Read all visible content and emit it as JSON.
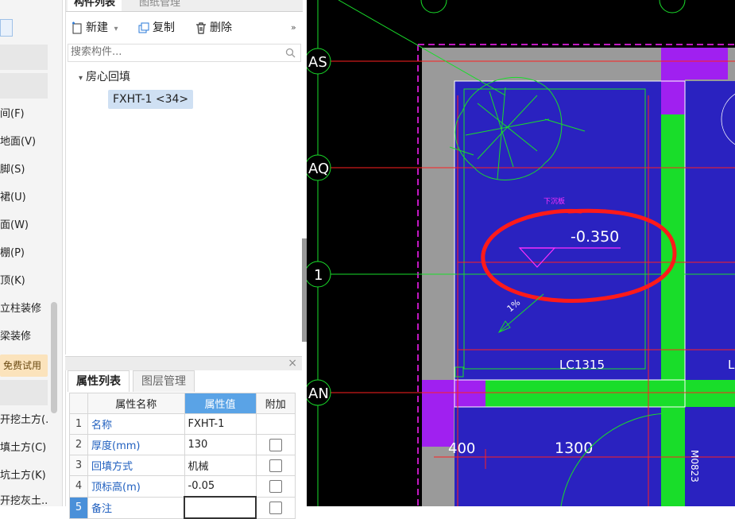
{
  "nav": {
    "items": [
      "间(F)",
      "地面(V)",
      "脚(S)",
      "裙(U)",
      "面(W)",
      "棚(P)",
      "顶(K)",
      "立柱装修",
      "梁装修",
      "开挖土方(.",
      "填土方(C)",
      "坑土方(K)",
      "开挖灰土.."
    ],
    "trial_label": "免费试用"
  },
  "component_panel": {
    "tabs": [
      "构件列表",
      "图纸管理"
    ],
    "toolbar": {
      "new_label": "新建",
      "copy_label": "复制",
      "delete_label": "删除",
      "more_label": "»"
    },
    "search_placeholder": "搜索构件...",
    "tree": {
      "group_label": "房心回填",
      "item_label": "FXHT-1 <34>"
    }
  },
  "property_panel": {
    "close_label": "×",
    "tabs": [
      "属性列表",
      "图层管理"
    ],
    "headers": [
      "属性名称",
      "属性值",
      "附加"
    ],
    "rows": [
      {
        "num": "1",
        "name": "名称",
        "value": "FXHT-1",
        "has_check": false
      },
      {
        "num": "2",
        "name": "厚度(mm)",
        "value": "130",
        "has_check": true
      },
      {
        "num": "3",
        "name": "回填方式",
        "value": "机械",
        "has_check": true
      },
      {
        "num": "4",
        "name": "顶标高(m)",
        "value": "-0.05",
        "has_check": true
      },
      {
        "num": "5",
        "name": "备注",
        "value": "",
        "has_check": true
      }
    ]
  },
  "cad": {
    "axis_labels": [
      "AS",
      "AQ",
      "1",
      "AN"
    ],
    "elevation_text": "-0.350",
    "small_magenta_text": "下沉板",
    "window_label": "LC1315",
    "window_label_cut": "L",
    "dim_400": "400",
    "dim_1300": "1300",
    "door_label": "M0823",
    "slope_text": "1%",
    "colors": {
      "background": "#000000",
      "room_fill": "#2a22c0",
      "wall_gray": "#9a9a9a",
      "column_green": "#19dd2a",
      "magenta": "#a020f0",
      "axis_red": "#ff2020",
      "annotation_red": "#ff1a1a"
    }
  }
}
